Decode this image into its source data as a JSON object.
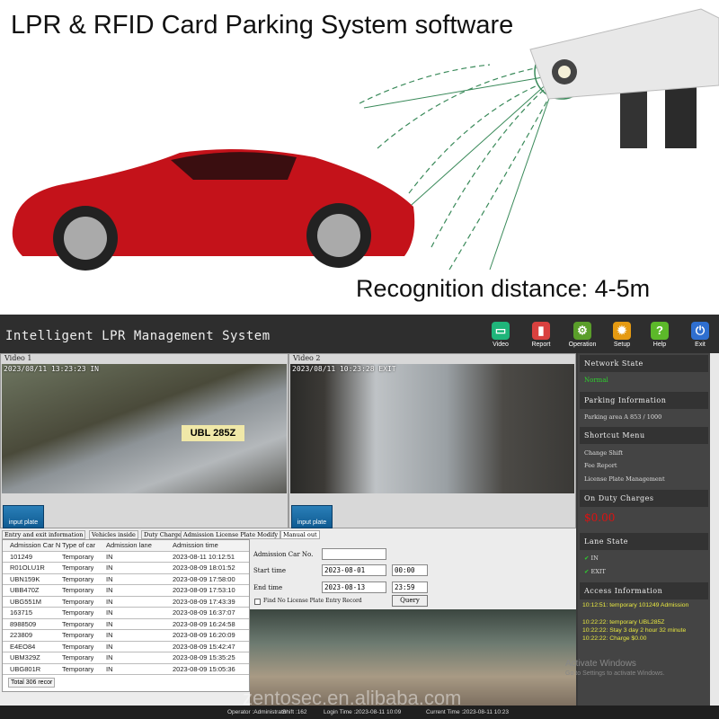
{
  "hero": {
    "title": "LPR & RFID Card Parking System software",
    "caption": "Recognition distance: 4-5m",
    "car_color": "#c4121a"
  },
  "app": {
    "title": "Intelligent LPR Management System",
    "toolbar": [
      {
        "label": "Video",
        "icon": "monitor-icon",
        "color": "#1fb57a"
      },
      {
        "label": "Report",
        "icon": "report-icon",
        "color": "#d9413f"
      },
      {
        "label": "Operation",
        "icon": "operation-icon",
        "color": "#5a9e2a"
      },
      {
        "label": "Setup",
        "icon": "gear-icon",
        "color": "#e59a12"
      },
      {
        "label": "Help",
        "icon": "help-icon",
        "color": "#5cb82a"
      },
      {
        "label": "Exit",
        "icon": "power-icon",
        "color": "#2f6fd0"
      }
    ],
    "videos": [
      {
        "label": "Video 1",
        "timestamp": "2023/08/11  13:23:23  IN",
        "button": "input plate",
        "plate": "UBL 285Z"
      },
      {
        "label": "Video 2",
        "timestamp": "2023/08/11  10:23:28  EXIT",
        "button": "input plate"
      }
    ],
    "tabs": [
      "Entry and exit information",
      "Vehicles inside",
      "Duty Charge",
      "Admission License Plate Modify",
      "Manual out"
    ],
    "table": {
      "columns": [
        "Admission Car N",
        "Type of car",
        "Admission lane",
        "Admission time"
      ],
      "rows": [
        [
          "101249",
          "Temporary",
          "IN",
          "2023-08-11 10:12:51"
        ],
        [
          "R01OLU1R",
          "Temporary",
          "IN",
          "2023-08-09 18:01:52"
        ],
        [
          "UBN159K",
          "Temporary",
          "IN",
          "2023-08-09 17:58:00"
        ],
        [
          "UBB470Z",
          "Temporary",
          "IN",
          "2023-08-09 17:53:10"
        ],
        [
          "UBG551M",
          "Temporary",
          "IN",
          "2023-08-09 17:43:39"
        ],
        [
          "163715",
          "Temporary",
          "IN",
          "2023-08-09 16:37:07"
        ],
        [
          "8988509",
          "Temporary",
          "IN",
          "2023-08-09 16:24:58"
        ],
        [
          "223809",
          "Temporary",
          "IN",
          "2023-08-09 16:20:09"
        ],
        [
          "E4EO84",
          "Temporary",
          "IN",
          "2023-08-09 15:42:47"
        ],
        [
          "UBM329Z",
          "Temporary",
          "IN",
          "2023-08-09 15:35:25"
        ],
        [
          "UBG801R",
          "Temporary",
          "IN",
          "2023-08-09 15:05:36"
        ]
      ],
      "total": "Total 306 recor"
    },
    "manual": {
      "car_no_label": "Admission Car No.",
      "car_no_value": "",
      "start_label": "Start time",
      "start_date": "2023-08-01",
      "start_time": "00:00",
      "end_label": "End time",
      "end_date": "2023-08-13",
      "end_time": "23:59",
      "checkbox_label": "Find No License Plate Entry Record",
      "query": "Query"
    },
    "sidebar": {
      "network_title": "Network State",
      "network_value": "Normal",
      "parking_title": "Parking Information",
      "parking_value": "Parking area A  853 / 1000",
      "shortcut_title": "Shortcut Menu",
      "shortcuts": [
        "Change Shift",
        "Fee Report",
        "License Plate Management"
      ],
      "charges_title": "On Duty Charges",
      "charges_value": "$0.00",
      "lane_title": "Lane State",
      "lanes": [
        "IN",
        "EXIT"
      ],
      "access_title": "Access Information",
      "access": [
        "10:12:51: temporary 101249 Admission",
        "10:22:22: temporary UBL285Z",
        "10:22:22: Stay 3 day 2 hour 32 minute",
        "10:22:22: Charge $0.00"
      ],
      "activate_title": "Activate Windows",
      "activate_sub": "Go to Settings to activate Windows."
    },
    "status": {
      "operator": "Operator :Administrator",
      "shift": "Shift :162",
      "login": "Login Time :2023-08-11 10:09",
      "current": "Current Time :2023-08-11 10:23"
    },
    "watermark": "zentosec.en.alibaba.com"
  }
}
